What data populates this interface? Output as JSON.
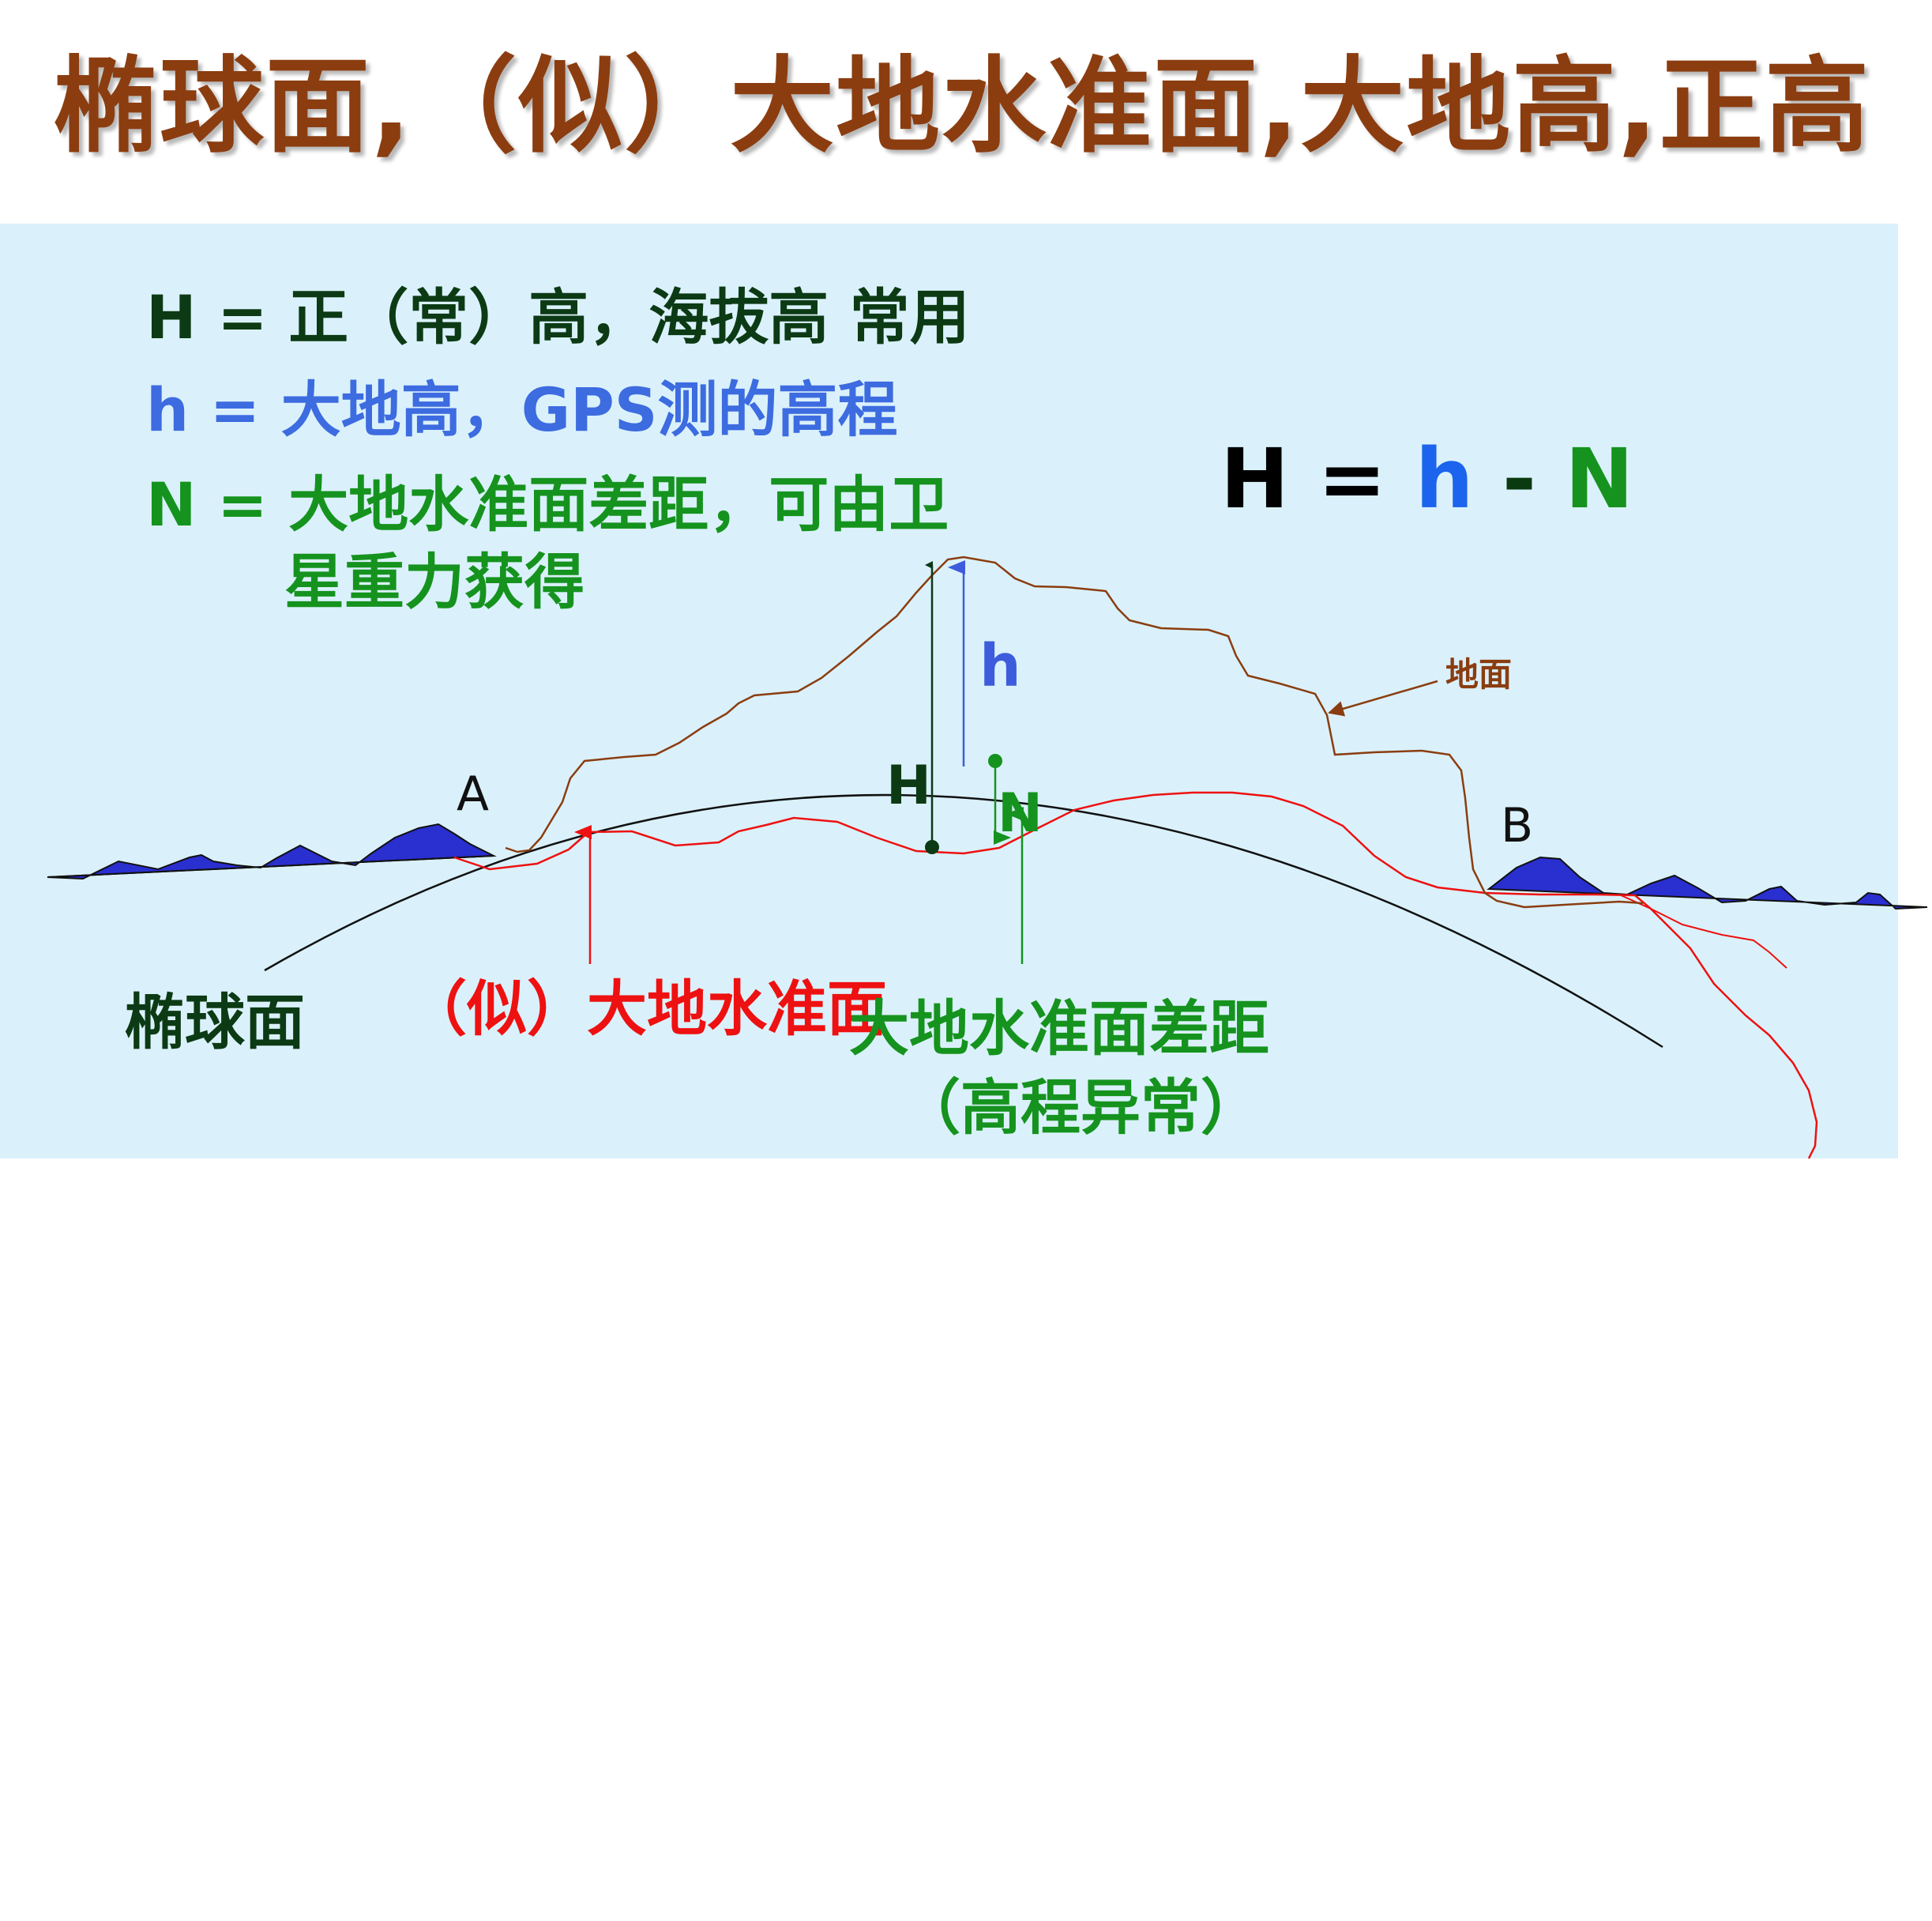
{
  "title": "椭球面,（似）大地水准面,大地高,正高",
  "legend": {
    "H_line": "H = 正（常）高，海拔高  常用",
    "h_line": "h = 大地高，GPS测的高程",
    "N_line1": "N = 大地水准面差距，可由卫",
    "N_line2": "星重力获得"
  },
  "formula": {
    "H": "H",
    "eq": " = ",
    "h": "h",
    "minus": " - ",
    "N": "N"
  },
  "labels": {
    "h": "h",
    "H": "H",
    "N": "N",
    "ground": "地面",
    "A": "A",
    "B": "B",
    "ellipsoid": "椭球面",
    "geoid": "（似）大地水准面",
    "separation_line1": "大地水准面差距",
    "separation_line2": "（高程异常）"
  },
  "colors": {
    "title": "#8b3d10",
    "panel_bg": "#daf1fb",
    "orthometric": "#0c3a14",
    "ellipsoidal": "#3d6be0",
    "separation": "#15931e",
    "geoid": "#ee1111",
    "ground": "#8b3d10",
    "ellipsoid_curve": "#111111",
    "sea_waves": "#2a2fd0"
  },
  "icons": {
    "ground_pointer": "arrow-icon",
    "geoid_pointer": "arrow-icon",
    "h_vector": "arrow-icon",
    "H_vector": "arrow-icon",
    "N_vector": "arrow-icon"
  }
}
